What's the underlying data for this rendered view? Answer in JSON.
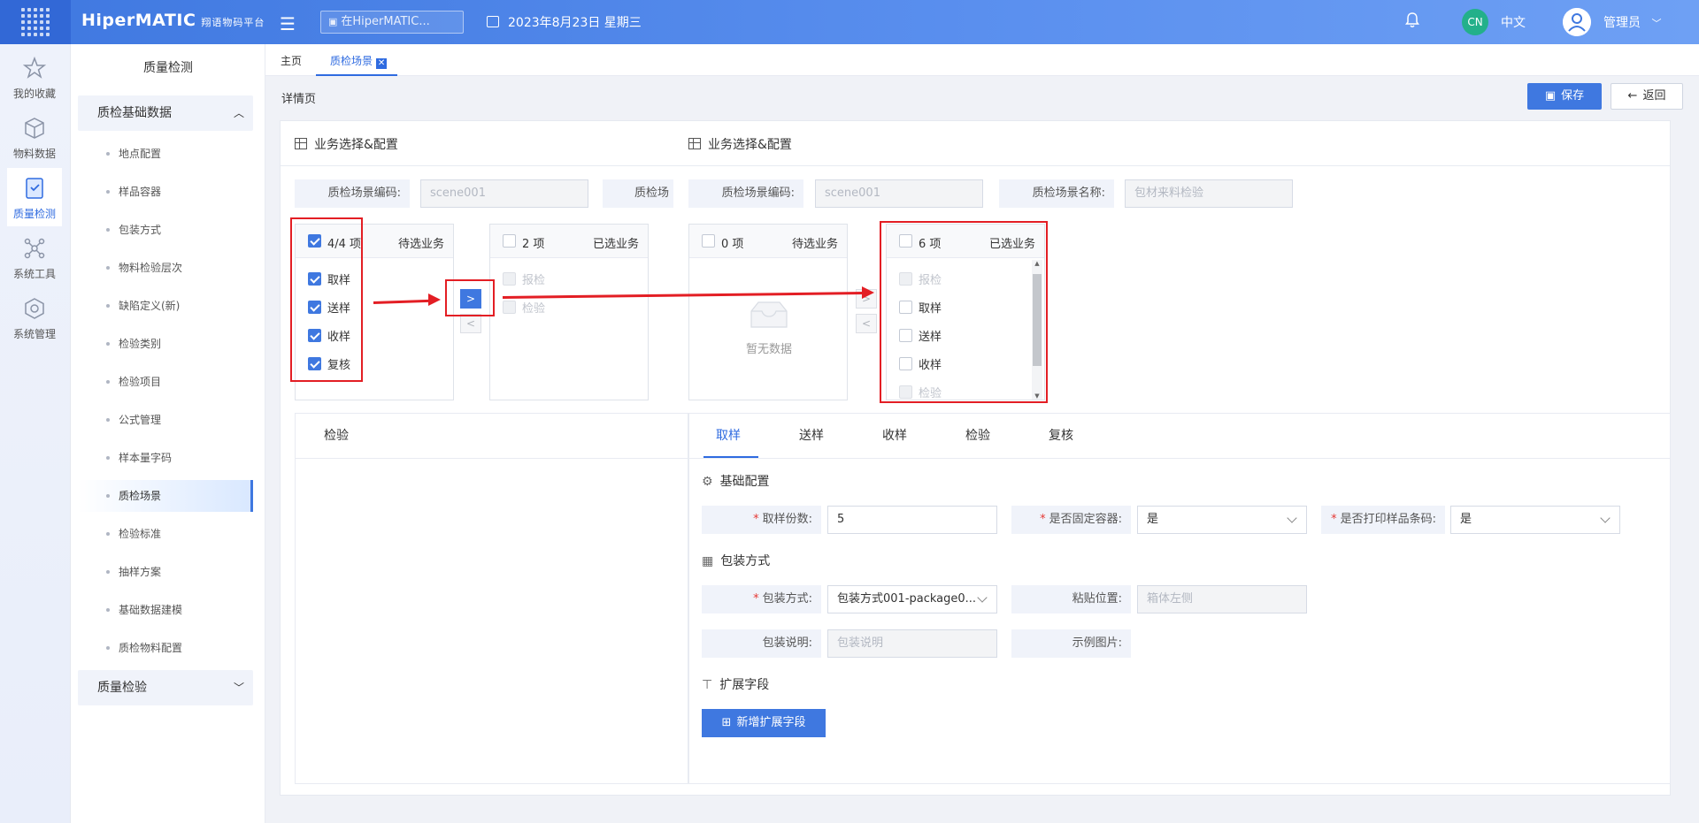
{
  "app": {
    "logo": "HiperMATIC",
    "logo_sub": "翔语物码平台",
    "search_placeholder": "在HiperMATIC...",
    "date": "2023年8月23日 星期三",
    "lang_badge": "CN",
    "lang": "中文",
    "user": "管理员"
  },
  "iconbar": [
    {
      "label": "我的收藏",
      "icon": "star-icon"
    },
    {
      "label": "物料数据",
      "icon": "cube-icon"
    },
    {
      "label": "质量检测",
      "icon": "shield-check-icon"
    },
    {
      "label": "系统工具",
      "icon": "network-icon"
    },
    {
      "label": "系统管理",
      "icon": "hex-gear-icon"
    }
  ],
  "sidebar": {
    "title": "质量检测",
    "group1": "质检基础数据",
    "items": [
      "地点配置",
      "样品容器",
      "包装方式",
      "物料检验层次",
      "缺陷定义(新)",
      "检验类别",
      "检验项目",
      "公式管理",
      "样本量字码",
      "质检场景",
      "检验标准",
      "抽样方案",
      "基础数据建模",
      "质检物料配置"
    ],
    "group2": "质量检验"
  },
  "tabs": {
    "home": "主页",
    "current": "质检场景"
  },
  "page": {
    "crumb": "详情页",
    "save": "保存",
    "back": "返回",
    "section_title": "业务选择&配置",
    "code_label": "质检场景编码:",
    "code_value": "scene001",
    "name_label": "质检场景名称:",
    "name_label_cut": "质检场",
    "name_value": "包材来料检验"
  },
  "transfer_left": {
    "source": {
      "count": "4/4 项",
      "title": "待选业务",
      "items": [
        "取样",
        "送样",
        "收样",
        "复核"
      ]
    },
    "target": {
      "count": "2 项",
      "title": "已选业务",
      "items": [
        "报检",
        "检验"
      ]
    }
  },
  "transfer_right": {
    "source": {
      "count": "0 项",
      "title": "待选业务",
      "empty": "暂无数据"
    },
    "target": {
      "count": "6 项",
      "title": "已选业务",
      "items": [
        "报检",
        "取样",
        "送样",
        "收样",
        "检验"
      ]
    }
  },
  "left_panel_tab": "检验",
  "panel_tabs": [
    "取样",
    "送样",
    "收样",
    "检验",
    "复核"
  ],
  "config": {
    "basic_title": "基础配置",
    "sample_count_label": "取样份数:",
    "sample_count_value": "5",
    "fixed_container_label": "是否固定容器:",
    "fixed_container_value": "是",
    "print_barcode_label": "是否打印样品条码:",
    "print_barcode_value": "是",
    "package_title": "包装方式",
    "package_label": "包装方式:",
    "package_value": "包装方式001-package0...",
    "stick_pos_label": "粘贴位置:",
    "stick_pos_value": "箱体左侧",
    "package_desc_label": "包装说明:",
    "package_desc_placeholder": "包装说明",
    "example_img_label": "示例图片:",
    "ext_title": "扩展字段",
    "add_ext_button": "新增扩展字段"
  },
  "colors": {
    "primary": "#3f78e0",
    "annotation": "#e31e24"
  }
}
